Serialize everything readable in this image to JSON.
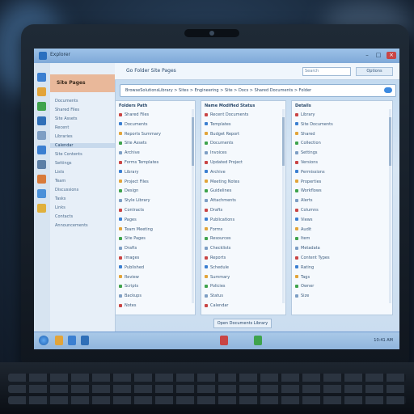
{
  "window": {
    "title": "Explorer"
  },
  "toolbar": {
    "title": "Go Folder Site Pages",
    "search_placeholder": "Search",
    "button": "Options"
  },
  "address": {
    "text": "BrowseSolutionsLibrary > Sites > Engineering > Site > Docs > Shared Documents > Folder"
  },
  "leftnav": {
    "header": "Site Pages",
    "items": [
      "Documents",
      "Shared Files",
      "Site Assets",
      "Recent",
      "Libraries",
      "Calendar",
      "Site Contents",
      "Settings",
      "Lists",
      "Team",
      "Discussions",
      "Tasks",
      "Links",
      "Contacts",
      "Announcements"
    ],
    "selected_index": 5
  },
  "panels": {
    "left": {
      "title": "Folders Path",
      "rows": [
        "Shared Files",
        "Documents",
        "Reports Summary",
        "Site Assets",
        "Archive",
        "Forms Templates",
        "Library",
        "Project Files",
        "Design",
        "Style Library",
        "Contracts",
        "Pages",
        "Team Meeting",
        "Site Pages",
        "Drafts",
        "Images",
        "Published",
        "Review",
        "Scripts",
        "Backups",
        "Notes"
      ]
    },
    "middle": {
      "title": "Name Modified Status",
      "rows": [
        "Recent Documents",
        "Templates",
        "Budget Report",
        "Documents",
        "Invoices",
        "Updated Project",
        "Archive",
        "Meeting Notes",
        "Guidelines",
        "Attachments",
        "Drafts",
        "Publications",
        "Forms",
        "Resources",
        "Checklists",
        "Reports",
        "Schedule",
        "Summary",
        "Policies",
        "Status",
        "Calendar"
      ]
    },
    "right": {
      "title": "Details",
      "rows": [
        "Library",
        "Site Documents",
        "Shared",
        "Collection",
        "Settings",
        "Versions",
        "Permissions",
        "Properties",
        "Workflows",
        "Alerts",
        "Columns",
        "Views",
        "Audit",
        "Item",
        "Metadata",
        "Content Types",
        "Rating",
        "Tags",
        "Owner",
        "Size"
      ]
    }
  },
  "footer_button": "Open Documents Library",
  "tray": {
    "time": "10:41 AM"
  },
  "colors": {
    "accent": "#3d8ae0",
    "nav_header": "#e9b89a",
    "selection": "#c7d9ec"
  }
}
